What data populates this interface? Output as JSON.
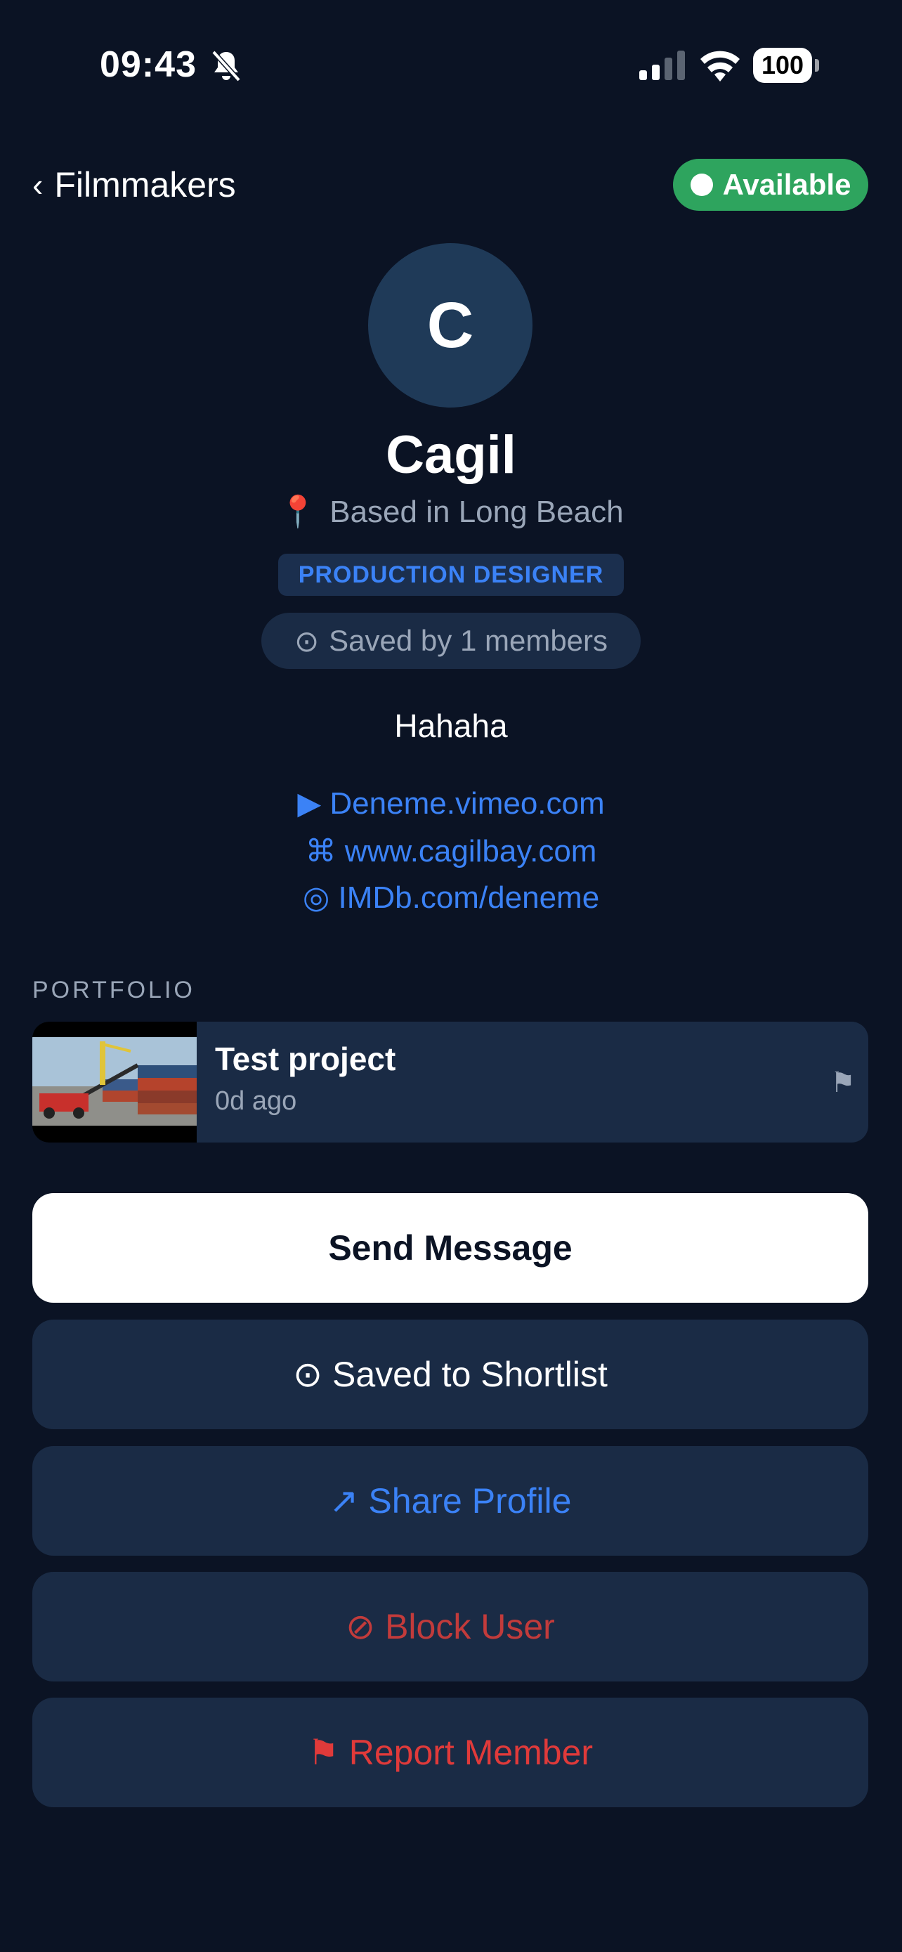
{
  "status_bar": {
    "time": "09:43",
    "battery": "100",
    "icons": [
      "bell-slash-icon",
      "cellular-signal-icon",
      "wifi-icon",
      "battery-icon"
    ]
  },
  "nav": {
    "back_label": "Filmmakers",
    "availability": "Available"
  },
  "profile": {
    "avatar_letter": "C",
    "name": "Cagil",
    "location": "Based in Long Beach",
    "role": "PRODUCTION DESIGNER",
    "saved_by": "Saved by 1 members",
    "bio": "Hahaha",
    "links": [
      {
        "icon": "play-icon",
        "glyph": "▶",
        "text": "Deneme.vimeo.com"
      },
      {
        "icon": "command-icon",
        "glyph": "⌘",
        "text": "www.cagilbay.com"
      },
      {
        "icon": "target-icon",
        "glyph": "◎",
        "text": "IMDb.com/deneme"
      }
    ]
  },
  "portfolio": {
    "label": "PORTFOLIO",
    "items": [
      {
        "title": "Test project",
        "meta": "0d ago"
      }
    ]
  },
  "actions": {
    "send_message": "Send Message",
    "shortlist": "Saved to Shortlist",
    "share": "Share Profile",
    "block": "Block User",
    "report": "Report Member"
  },
  "colors": {
    "background": "#0b1324",
    "card": "#1a2b45",
    "accent": "#3b82f6",
    "available": "#2ea45e",
    "danger": "#e03a3a"
  }
}
